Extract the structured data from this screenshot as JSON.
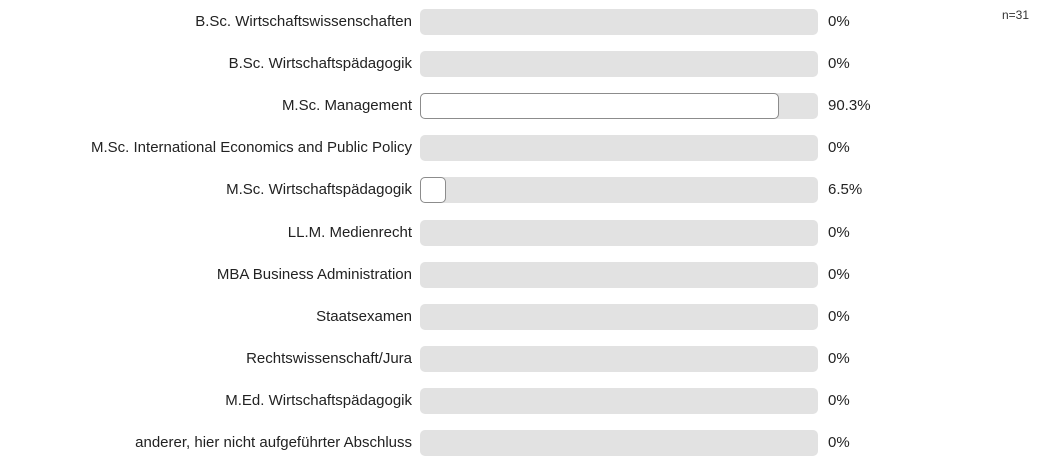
{
  "sample_size": "n=31",
  "chart_data": {
    "type": "bar",
    "orientation": "horizontal",
    "categories": [
      "B.Sc. Wirtschaftswissenschaften",
      "B.Sc. Wirtschaftspädagogik",
      "M.Sc. Management",
      "M.Sc. International Economics and Public Policy",
      "M.Sc. Wirtschaftspädagogik",
      "LL.M. Medienrecht",
      "MBA Business Administration",
      "Staatsexamen",
      "Rechtswissenschaft/Jura",
      "M.Ed. Wirtschaftspädagogik",
      "anderer, hier nicht aufgeführter Abschluss"
    ],
    "values": [
      0,
      0,
      90.3,
      0,
      6.5,
      0,
      0,
      0,
      0,
      0,
      0
    ],
    "value_labels": [
      "0%",
      "0%",
      "90.3%",
      "0%",
      "6.5%",
      "0%",
      "0%",
      "0%",
      "0%",
      "0%",
      "0%"
    ],
    "unit": "%",
    "xlim": [
      0,
      100
    ],
    "grid": false,
    "legend": "none",
    "colors": {
      "track": "#e2e2e2",
      "fill": "#ffffff",
      "fill_border": "#8c8c8c"
    }
  }
}
